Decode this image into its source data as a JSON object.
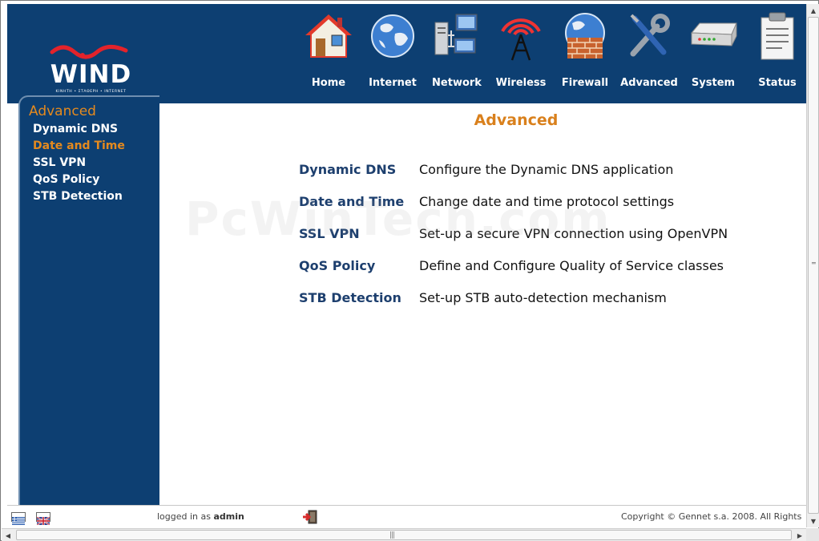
{
  "brand": {
    "logo_text": "WIND",
    "tagline": "ΚΙΝΗΤΗ • ΣΤΑΘΕΡΗ • INTERNET"
  },
  "nav": [
    {
      "label": "Home",
      "icon": "home-icon"
    },
    {
      "label": "Internet",
      "icon": "globe-icon"
    },
    {
      "label": "Network",
      "icon": "network-computers-icon"
    },
    {
      "label": "Wireless",
      "icon": "wireless-antenna-icon"
    },
    {
      "label": "Firewall",
      "icon": "firewall-icon"
    },
    {
      "label": "Advanced",
      "icon": "tools-icon"
    },
    {
      "label": "System",
      "icon": "router-device-icon"
    },
    {
      "label": "Status",
      "icon": "clipboard-icon"
    }
  ],
  "sidebar": {
    "title": "Advanced",
    "items": [
      {
        "label": "Dynamic DNS",
        "active": false
      },
      {
        "label": "Date and Time",
        "active": true
      },
      {
        "label": "SSL VPN",
        "active": false
      },
      {
        "label": "QoS Policy",
        "active": false
      },
      {
        "label": "STB Detection",
        "active": false
      }
    ]
  },
  "main": {
    "title": "Advanced",
    "rows": [
      {
        "link": "Dynamic DNS",
        "description": "Configure the Dynamic DNS application"
      },
      {
        "link": "Date and Time",
        "description": "Change date and time protocol settings"
      },
      {
        "link": "SSL VPN",
        "description": "Set-up a secure VPN connection using OpenVPN"
      },
      {
        "link": "QoS Policy",
        "description": "Define and Configure Quality of Service classes"
      },
      {
        "link": "STB Detection",
        "description": "Set-up STB auto-detection mechanism"
      }
    ],
    "watermark": "PcWinTech.com"
  },
  "footer": {
    "logged_prefix": "logged in as",
    "user": "admin",
    "copyright": "Copyright © Gennet s.a. 2008. All Rights",
    "languages": [
      "greek-flag-icon",
      "uk-flag-icon"
    ],
    "logout_icon": "logout-door-icon"
  },
  "colors": {
    "navy": "#0d3f72",
    "accent_orange": "#e58a1e",
    "link_blue": "#1d3f6e"
  }
}
